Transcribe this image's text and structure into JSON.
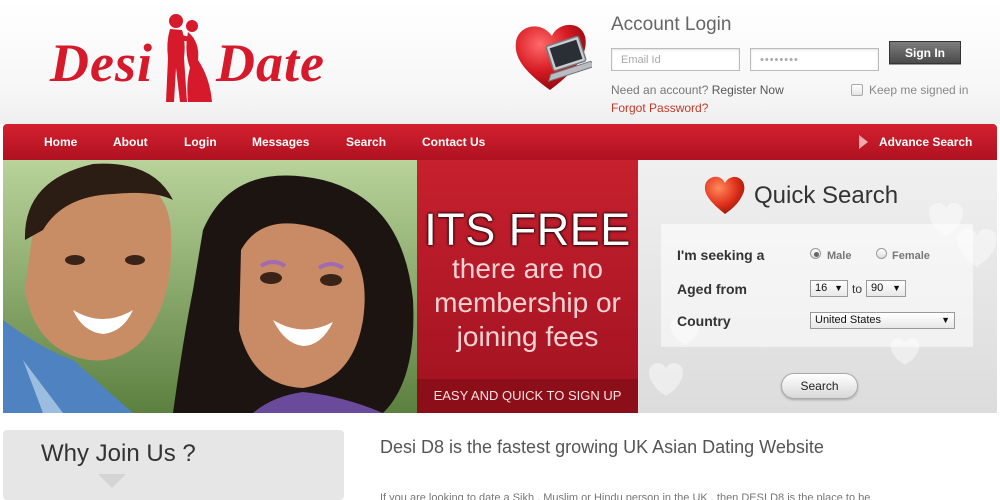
{
  "brand": {
    "word1": "Desi",
    "word2": "Date",
    "red": "#d6192b"
  },
  "account": {
    "title": "Account Login",
    "email_placeholder": "Email Id",
    "password_value": "••••••••",
    "signin_label": "Sign In",
    "need_account": "Need an account?",
    "register_label": "Register Now",
    "forgot_label": "Forgot Password?",
    "keep_signed_in": "Keep me signed in"
  },
  "nav": {
    "items": [
      "Home",
      "About",
      "Login",
      "Messages",
      "Search",
      "Contact Us"
    ],
    "advance": "Advance Search"
  },
  "hero": {
    "free_title": "ITS FREE",
    "free_sub": "there are no membership or joining fees",
    "free_bar": "EASY AND QUICK TO SIGN UP"
  },
  "quick_search": {
    "title": "Quick Search",
    "seeking_label": "I'm seeking a",
    "male": "Male",
    "female": "Female",
    "aged_label": "Aged from",
    "age_from": "16",
    "to_text": "to",
    "age_to": "90",
    "country_label": "Country",
    "country_value": "United States",
    "search_button": "Search"
  },
  "content": {
    "why_title": "Why Join Us ?",
    "fastest": "Desi D8 is the fastest growing UK Asian Dating Website",
    "intro": "If you are looking to date a Sikh , Muslim or Hindu person in the UK , then DESI D8 is the place to be"
  }
}
